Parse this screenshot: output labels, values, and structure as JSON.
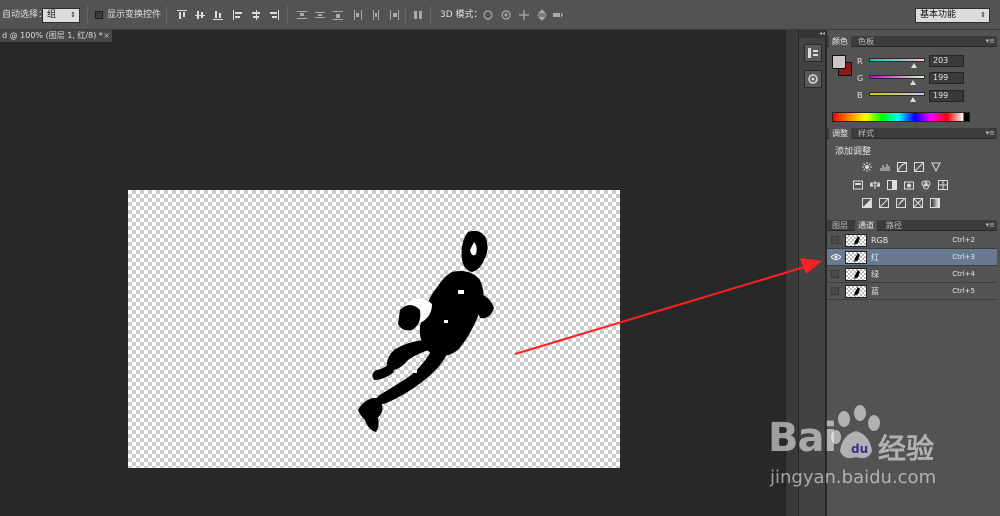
{
  "options_bar": {
    "auto_select_label": "自动选择：",
    "auto_select_value": "组",
    "show_transform_label": "显示变换控件",
    "mode_3d_label": "3D 模式：",
    "workspace_value": "基本功能"
  },
  "document_tab": {
    "title": "d @ 100% (图层 1, 红/8) *",
    "close": "×"
  },
  "dock": {
    "collapse": "◂◂"
  },
  "color_panel": {
    "tabs": [
      "颜色",
      "色板"
    ],
    "foreground": "#cbc7c7",
    "background": "#8b1a1a",
    "channels": [
      {
        "label": "R",
        "value": "203",
        "fraction": 0.8
      },
      {
        "label": "G",
        "value": "199",
        "fraction": 0.78
      },
      {
        "label": "B",
        "value": "199",
        "fraction": 0.78
      }
    ]
  },
  "adjustments_panel": {
    "tabs": [
      "调整",
      "样式"
    ],
    "title": "添加调整",
    "icons": [
      [
        "brightness-icon",
        "levels-icon",
        "curves-icon",
        "exposure-icon",
        "vibrance-icon"
      ],
      [
        "hue-saturation-icon",
        "color-balance-icon",
        "black-white-icon",
        "photo-filter-icon",
        "channel-mixer-icon",
        "color-lookup-icon"
      ],
      [
        "invert-icon",
        "posterize-icon",
        "threshold-icon",
        "selective-color-icon",
        "gradient-map-icon"
      ]
    ]
  },
  "channels_panel": {
    "tabs": [
      "图层",
      "通道",
      "路径"
    ],
    "rows": [
      {
        "name": "RGB",
        "shortcut": "Ctrl+2",
        "visible": false,
        "selected": false
      },
      {
        "name": "红",
        "shortcut": "Ctrl+3",
        "visible": true,
        "selected": true
      },
      {
        "name": "绿",
        "shortcut": "Ctrl+4",
        "visible": false,
        "selected": false
      },
      {
        "name": "蓝",
        "shortcut": "Ctrl+5",
        "visible": false,
        "selected": false
      }
    ]
  },
  "annotation": {
    "arrow_color": "#ff2020"
  },
  "watermark": {
    "brand": "Bai",
    "brand_suffix": "经验",
    "url": "jingyan.baidu.com"
  }
}
